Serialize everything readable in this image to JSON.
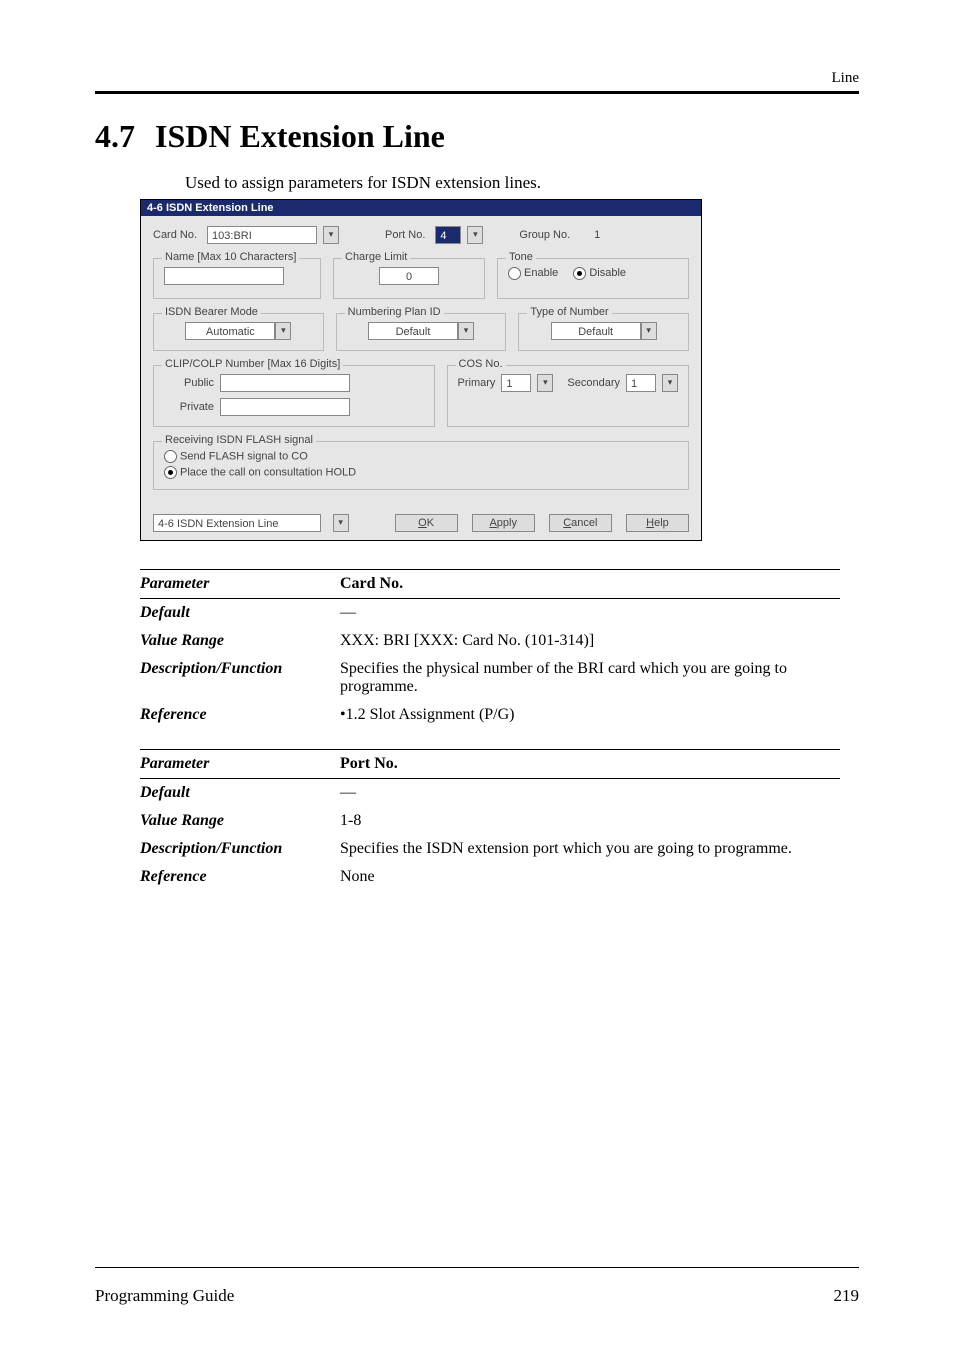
{
  "header": {
    "corner": "Line"
  },
  "section": {
    "number": "4.7",
    "title": "ISDN Extension Line"
  },
  "intro": "Used to assign parameters for ISDN extension lines.",
  "dialog": {
    "title": "4-6 ISDN Extension Line",
    "card_no_label": "Card No.",
    "card_no_value": "103:BRI",
    "port_no_label": "Port No.",
    "port_no_value": "4",
    "group_no_label": "Group No.",
    "group_no_value": "1",
    "name_legend": "Name [Max 10 Characters]",
    "name_value": "",
    "charge_legend": "Charge Limit",
    "charge_value": "0",
    "tone_legend": "Tone",
    "tone_enable": "Enable",
    "tone_disable": "Disable",
    "bearer_legend": "ISDN Bearer Mode",
    "bearer_value": "Automatic",
    "plan_legend": "Numbering Plan ID",
    "plan_value": "Default",
    "numtype_legend": "Type of Number",
    "numtype_value": "Default",
    "clip_legend": "CLIP/COLP Number [Max 16 Digits]",
    "clip_public_label": "Public",
    "clip_public_value": "",
    "clip_private_label": "Private",
    "clip_private_value": "",
    "cos_legend": "COS No.",
    "cos_primary_label": "Primary",
    "cos_primary_value": "1",
    "cos_secondary_label": "Secondary",
    "cos_secondary_value": "1",
    "flash_legend": "Receiving ISDN FLASH signal",
    "flash_send": "Send FLASH signal to CO",
    "flash_hold": "Place the call on consultation HOLD",
    "nav_value": "4-6 ISDN Extension Line",
    "ok_u": "O",
    "ok_rest": "K",
    "apply_u": "A",
    "apply_rest": "pply",
    "cancel_u": "C",
    "cancel_rest": "ancel",
    "help_u": "H",
    "help_rest": "elp"
  },
  "p1": {
    "parameter_label": "Parameter",
    "parameter_value": "Card No.",
    "default_label": "Default",
    "default_value": "—",
    "range_label": "Value Range",
    "range_value": "XXX: BRI [XXX: Card No. (101-314)]",
    "desc_label": "Description/Function",
    "desc_value": "Specifies the physical number of the BRI card which you are going to programme.",
    "ref_label": "Reference",
    "ref_value": "•1.2   Slot Assignment (P/G)"
  },
  "p2": {
    "parameter_label": "Parameter",
    "parameter_value": "Port No.",
    "default_label": "Default",
    "default_value": "—",
    "range_label": "Value Range",
    "range_value": "1-8",
    "desc_label": "Description/Function",
    "desc_value": "Specifies the ISDN extension port which you are going to programme.",
    "ref_label": "Reference",
    "ref_value": "None"
  },
  "footer": {
    "left": "Programming Guide",
    "right": "219"
  }
}
